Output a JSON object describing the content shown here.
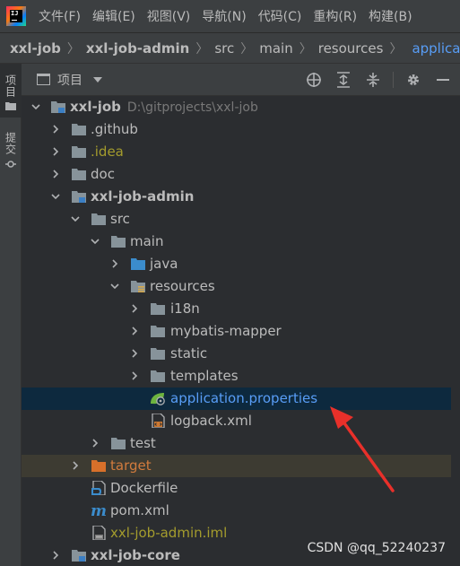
{
  "menubar": {
    "items": [
      "文件(F)",
      "编辑(E)",
      "视图(V)",
      "导航(N)",
      "代码(C)",
      "重构(R)",
      "构建(B)"
    ]
  },
  "breadcrumb": {
    "items": [
      "xxl-job",
      "xxl-job-admin",
      "src",
      "main",
      "resources",
      "application.p"
    ]
  },
  "toolstrip": {
    "project_label": "项目",
    "commit_label": "提交"
  },
  "panel": {
    "title": "项目"
  },
  "tree": {
    "root_name": "xxl-job",
    "root_path": "D:\\gitprojects\\xxl-job",
    "github": ".github",
    "idea": ".idea",
    "doc": "doc",
    "admin": "xxl-job-admin",
    "src": "src",
    "main": "main",
    "java": "java",
    "resources": "resources",
    "i18n": "i18n",
    "mybatis": "mybatis-mapper",
    "static": "static",
    "templates": "templates",
    "app_props": "application.properties",
    "logback": "logback.xml",
    "test": "test",
    "target": "target",
    "dockerfile": "Dockerfile",
    "pom": "pom.xml",
    "iml": "xxl-job-admin.iml",
    "core": "xxl-job-core"
  },
  "watermark": "CSDN @qq_52240237",
  "colors": {
    "background": "#2b2d30",
    "selected_row": "#0d293e",
    "excluded_row": "#3d3b32",
    "link_blue": "#589df6",
    "ignored_yellow": "#a49c2d",
    "excluded_orange": "#d27b3d",
    "annotation_red": "#e8302a"
  }
}
